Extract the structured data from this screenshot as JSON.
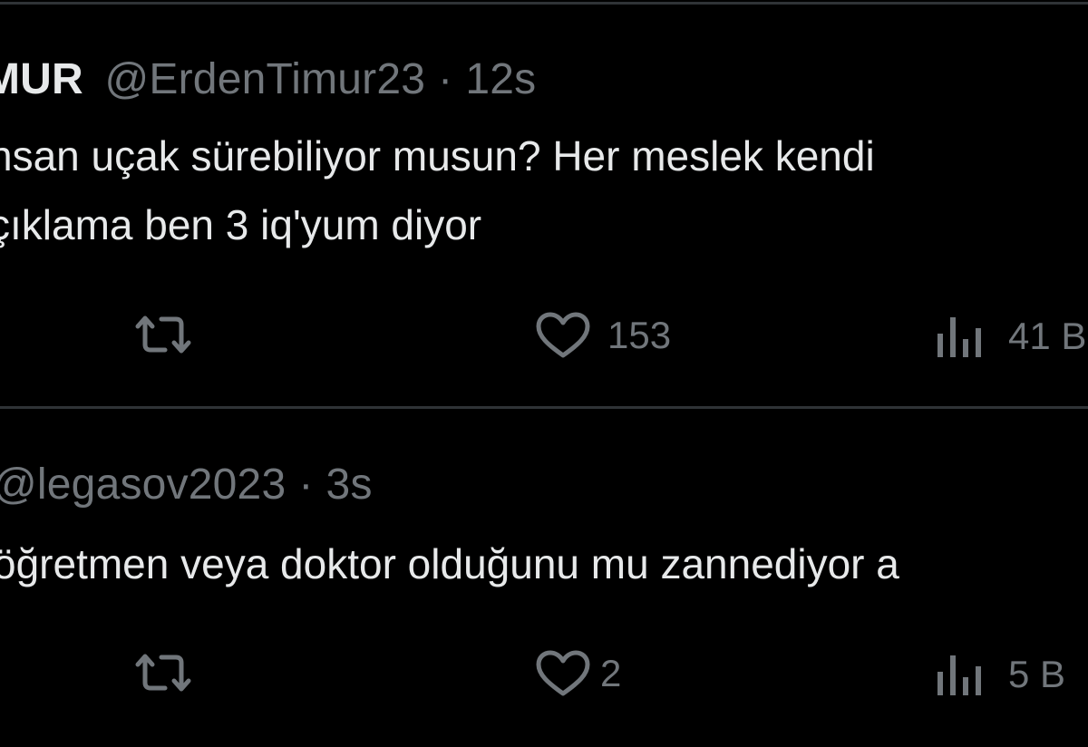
{
  "tweets": [
    {
      "display_name": "MUR",
      "handle": "@ErdenTimur23",
      "separator": "·",
      "time": "12s",
      "text_lines": [
        "nsan uçak sürebiliyor musun? Her meslek kendi",
        "çıklama ben 3 iq'yum diyor"
      ],
      "actions": {
        "retweet_icon": "retweet-icon",
        "like_icon": "heart-icon",
        "like_count": "153",
        "views_icon": "bar-chart-icon",
        "views_count": "41 B"
      }
    },
    {
      "handle": "@legasov2023",
      "separator": "·",
      "time": "3s",
      "text_lines": [
        "öğretmen veya doktor olduğunu mu zannediyor a"
      ],
      "actions": {
        "retweet_icon": "retweet-icon",
        "like_icon": "heart-icon",
        "like_count": "2",
        "views_icon": "bar-chart-icon",
        "views_count": "5 B"
      }
    }
  ],
  "colors": {
    "background": "#000000",
    "primary_text": "#e7e9ea",
    "secondary_text": "#71767b",
    "divider": "#2f3336"
  }
}
